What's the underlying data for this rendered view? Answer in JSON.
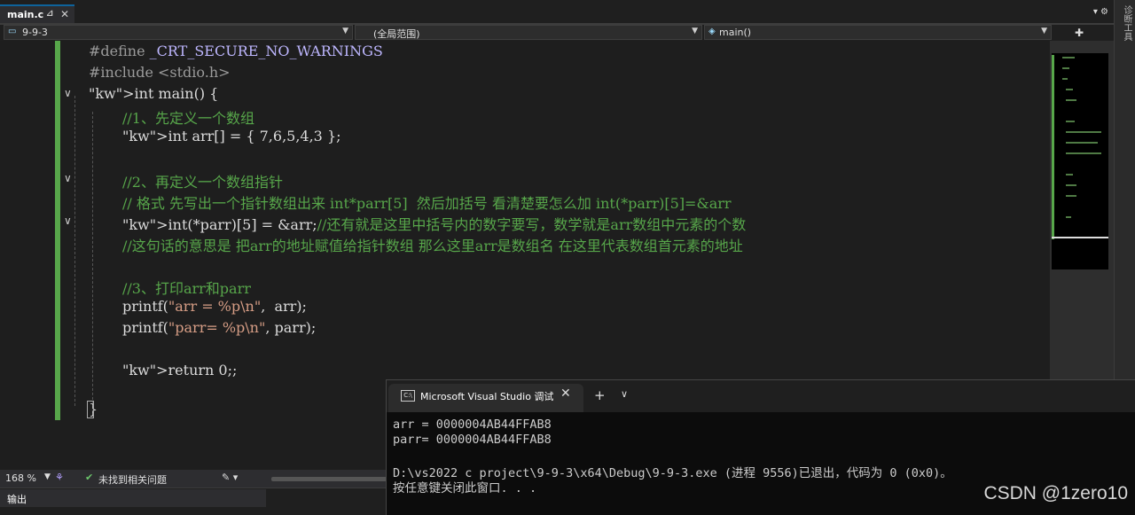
{
  "tabs": [
    {
      "label": "main.c",
      "pin": "⊿",
      "close": "✕"
    }
  ],
  "side_panel_label": "诊断工具",
  "navbar": {
    "project": "9-9-3",
    "scope": "(全局范围)",
    "function": "main()"
  },
  "code_lines": [
    "#define _CRT_SECURE_NO_WARNINGS",
    "#include <stdio.h>",
    "int main() {",
    "//1、先定义一个数组",
    "int arr[] = { 7,6,5,4,3 };",
    "",
    "//2、再定义一个数组指针",
    "// 格式 先写出一个指针数组出来 int*parr[5]  然后加括号 看清楚要怎么加 int(*parr)[5]=&arr",
    "int(*parr)[5] = &arr;//还有就是这里中括号内的数字要写，数学就是arr数组中元素的个数",
    "//这句话的意思是 把arr的地址赋值给指针数组 那么这里arr是数组名 在这里代表数组首元素的地址",
    "",
    "//3、打印arr和parr",
    "printf(\"arr = %p\\n\",  arr);",
    "printf(\"parr= %p\\n\", parr);",
    "",
    "return 0;;",
    "",
    "}"
  ],
  "status": {
    "zoom": "168 %",
    "issues": "未找到相关问题"
  },
  "output_tab": "输出",
  "console": {
    "title": "Microsoft Visual Studio 调试控制台",
    "lines": [
      "arr = 0000004AB44FFAB8",
      "parr= 0000004AB44FFAB8",
      "",
      "D:\\vs2022 c project\\9-9-3\\x64\\Debug\\9-9-3.exe (进程 9556)已退出，代码为 0 (0x0)。",
      "按任意键关闭此窗口. . ."
    ]
  },
  "watermark": "CSDN @1zero10",
  "colors": {
    "keyword": "#569cd6",
    "comment": "#57a64a",
    "string": "#d69d85",
    "accent": "#0e639c"
  }
}
